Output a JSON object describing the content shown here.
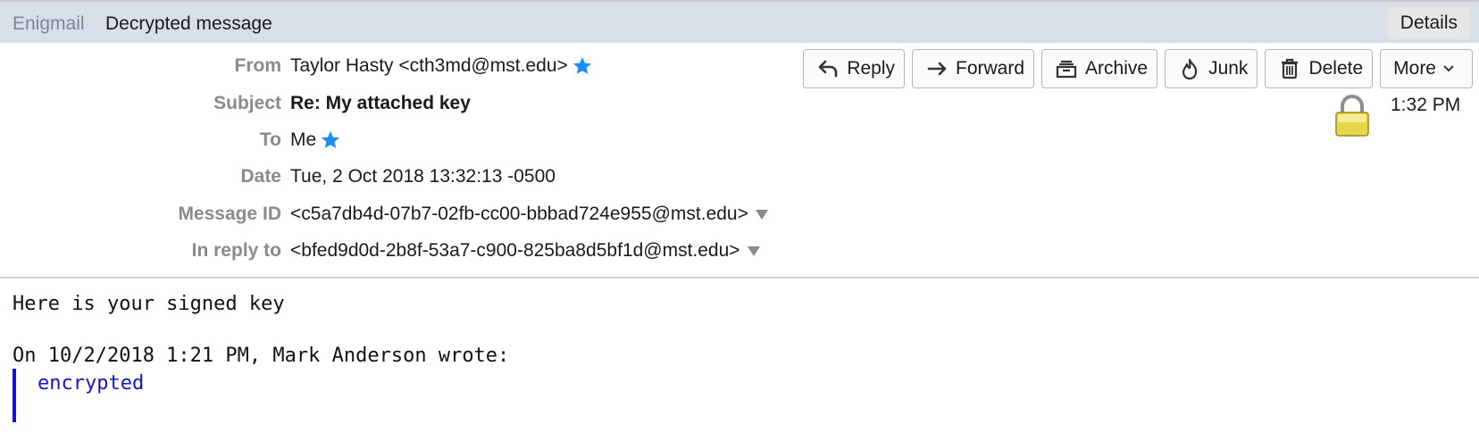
{
  "enigmail": {
    "label": "Enigmail",
    "status": "Decrypted message",
    "details_label": "Details"
  },
  "headers": {
    "from": {
      "label": "From",
      "value": "Taylor Hasty <cth3md@mst.edu>"
    },
    "subject": {
      "label": "Subject",
      "value": "Re: My attached key"
    },
    "to": {
      "label": "To",
      "value": "Me"
    },
    "date": {
      "label": "Date",
      "value": "Tue, 2 Oct 2018 13:32:13 -0500"
    },
    "message_id": {
      "label": "Message ID",
      "value": "<c5a7db4d-07b7-02fb-cc00-bbbad724e955@mst.edu>"
    },
    "in_reply_to": {
      "label": "In reply to",
      "value": "<bfed9d0d-2b8f-53a7-c900-825ba8d5bf1d@mst.edu>"
    }
  },
  "toolbar": {
    "reply": "Reply",
    "forward": "Forward",
    "archive": "Archive",
    "junk": "Junk",
    "delete": "Delete",
    "more": "More"
  },
  "time": "1:32 PM",
  "body": {
    "line1": "Here is your signed key",
    "line2": "On 10/2/2018 1:21 PM, Mark Anderson wrote:",
    "quoted": "encrypted"
  },
  "icons": {
    "star_color": "#1a8cff",
    "quote_color": "#1414d6"
  }
}
